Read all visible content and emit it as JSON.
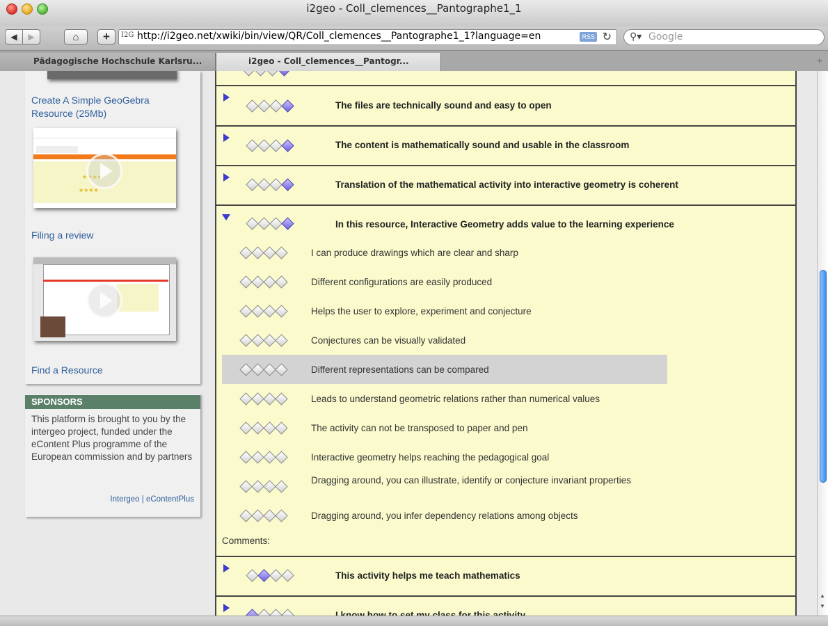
{
  "window": {
    "title": "i2geo - Coll_clemences__Pantographe1_1"
  },
  "toolbar": {
    "url": "http://i2geo.net/xwiki/bin/view/QR/Coll_clemences__Pantographe1_1?language=en",
    "favicon": "I2G",
    "rss": "RSS",
    "search_placeholder": "Google"
  },
  "tabs": [
    {
      "label": "Pädagogische Hochschule Karlsru..."
    },
    {
      "label": "i2geo - Coll_clemences__Pantogr..."
    }
  ],
  "sidebar": {
    "link_create": "Create A Simple GeoGebra Resource (25Mb)",
    "link_filing": "Filing a review",
    "link_find": "Find a Resource",
    "sponsors_title": "SPONSORS",
    "sponsors_text": "This platform is brought to you by the intergeo project, funded under the eContent Plus programme of the European commission and by partners",
    "sponsors_links": "Intergeo | eContentPlus"
  },
  "criteria": [
    {
      "label": "The files are technically sound and easy to open",
      "rating": 4,
      "expanded": false
    },
    {
      "label": "The content is mathematically sound and usable in the classroom",
      "rating": 4,
      "expanded": false
    },
    {
      "label": "Translation of the mathematical activity into interactive geometry is coherent",
      "rating": 4,
      "expanded": false
    },
    {
      "label": "In this resource, Interactive Geometry adds value to the learning experience",
      "rating": 4,
      "expanded": true
    },
    {
      "label": "This activity helps me teach mathematics",
      "rating": 2,
      "expanded": false
    },
    {
      "label": "I know how to set my class for this activity",
      "rating": 1,
      "expanded": false
    }
  ],
  "subcriteria": [
    {
      "label": "I can produce drawings which are clear and sharp",
      "rating": 0
    },
    {
      "label": "Different configurations are easily produced",
      "rating": 0
    },
    {
      "label": "Helps the user to explore, experiment and conjecture",
      "rating": 0
    },
    {
      "label": "Conjectures can be visually validated",
      "rating": 0
    },
    {
      "label": "Different representations can be compared",
      "rating": 0,
      "highlighted": true
    },
    {
      "label": "Leads to understand geometric relations rather than numerical values",
      "rating": 0
    },
    {
      "label": "The activity can not be transposed to paper and pen",
      "rating": 0
    },
    {
      "label": "Interactive geometry helps reaching the pedagogical goal",
      "rating": 0
    },
    {
      "label": "Dragging around, you can illustrate, identify or conjecture invariant properties",
      "rating": 0
    },
    {
      "label": "Dragging around, you infer dependency relations among objects",
      "rating": 0
    }
  ],
  "comments_label": "Comments:"
}
